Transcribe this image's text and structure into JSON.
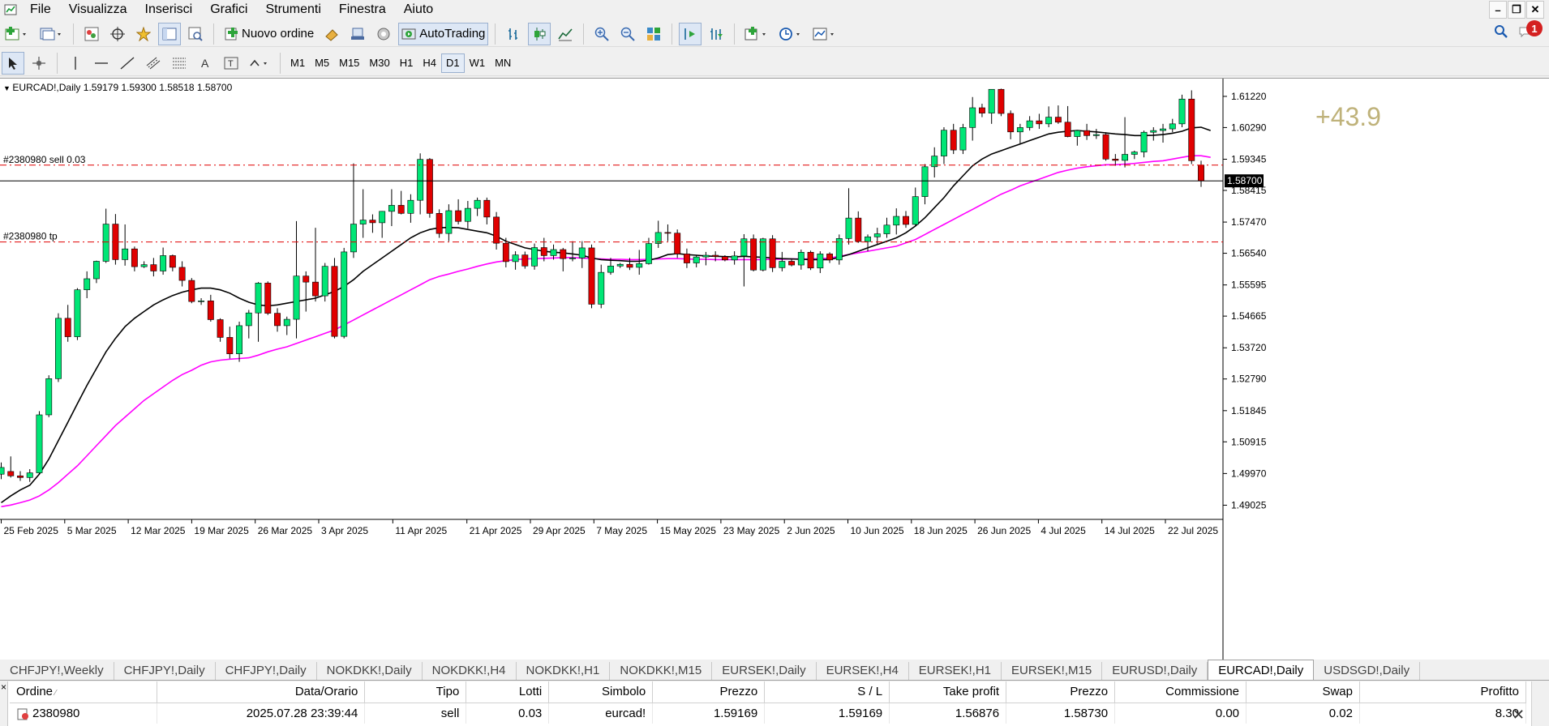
{
  "menu": {
    "items": [
      "File",
      "Visualizza",
      "Inserisci",
      "Grafici",
      "Strumenti",
      "Finestra",
      "Aiuto"
    ]
  },
  "toolbar": {
    "new_order_label": "Nuovo ordine",
    "autotrading_label": "AutoTrading",
    "notification_count": "1"
  },
  "timeframes": [
    "M1",
    "M5",
    "M15",
    "M30",
    "H1",
    "H4",
    "D1",
    "W1",
    "MN"
  ],
  "active_timeframe": "D1",
  "chart": {
    "title": "EURCAD!,Daily  1.59179 1.59300 1.58518 1.58700",
    "sell_label": "#2380980 sell 0.03",
    "tp_label": "#2380980 tp",
    "profit_overlay": "+43.9",
    "current_price_label": "1.58700",
    "price_ticks": [
      "1.61220",
      "1.60290",
      "1.59345",
      "1.58415",
      "1.57470",
      "1.56540",
      "1.55595",
      "1.54665",
      "1.53720",
      "1.52790",
      "1.51845",
      "1.50915",
      "1.49970",
      "1.49025"
    ],
    "date_ticks": [
      "25 Feb 2025",
      "5 Mar 2025",
      "12 Mar 2025",
      "19 Mar 2025",
      "26 Mar 2025",
      "3 Apr 2025",
      "11 Apr 2025",
      "21 Apr 2025",
      "29 Apr 2025",
      "7 May 2025",
      "15 May 2025",
      "23 May 2025",
      "2 Jun 2025",
      "10 Jun 2025",
      "18 Jun 2025",
      "26 Jun 2025",
      "4 Jul 2025",
      "14 Jul 2025",
      "22 Jul 2025"
    ]
  },
  "chart_data": {
    "type": "candlestick",
    "symbol": "EURCAD!",
    "timeframe": "Daily",
    "ylim": [
      1.4865,
      1.6175
    ],
    "sell_price": 1.59169,
    "tp_price": 1.56876,
    "current_price": 1.587,
    "colors": {
      "bull": "#00e676",
      "bear": "#e00000",
      "ma_fast": "#000000",
      "ma_slow": "#ff00ff",
      "order_line": "#e00000"
    },
    "candles": [
      [
        1.4995,
        1.503,
        1.498,
        1.5015
      ],
      [
        1.5003,
        1.5048,
        1.4985,
        1.499
      ],
      [
        1.499,
        1.5004,
        1.4975,
        1.4985
      ],
      [
        1.4985,
        1.501,
        1.4972,
        1.4999
      ],
      [
        1.4999,
        1.5183,
        1.4995,
        1.5172
      ],
      [
        1.5172,
        1.529,
        1.5165,
        1.528
      ],
      [
        1.528,
        1.5475,
        1.527,
        1.546
      ],
      [
        1.546,
        1.55,
        1.539,
        1.5405
      ],
      [
        1.5405,
        1.555,
        1.5395,
        1.5545
      ],
      [
        1.5545,
        1.56,
        1.552,
        1.5578
      ],
      [
        1.5578,
        1.5632,
        1.5565,
        1.563
      ],
      [
        1.563,
        1.5787,
        1.5625,
        1.5741
      ],
      [
        1.5741,
        1.5771,
        1.562,
        1.5635
      ],
      [
        1.5635,
        1.574,
        1.5617,
        1.5667
      ],
      [
        1.5667,
        1.5674,
        1.56,
        1.5614
      ],
      [
        1.5614,
        1.563,
        1.561,
        1.562
      ],
      [
        1.562,
        1.564,
        1.5585,
        1.5601
      ],
      [
        1.5601,
        1.5671,
        1.559,
        1.5647
      ],
      [
        1.5647,
        1.565,
        1.56,
        1.5612
      ],
      [
        1.5612,
        1.563,
        1.5555,
        1.5573
      ],
      [
        1.5573,
        1.558,
        1.5505,
        1.551
      ],
      [
        1.551,
        1.552,
        1.55,
        1.5512
      ],
      [
        1.5512,
        1.553,
        1.545,
        1.5456
      ],
      [
        1.5456,
        1.546,
        1.539,
        1.5403
      ],
      [
        1.5403,
        1.5435,
        1.534,
        1.5354
      ],
      [
        1.5354,
        1.545,
        1.533,
        1.5438
      ],
      [
        1.5438,
        1.5485,
        1.54,
        1.5476
      ],
      [
        1.5476,
        1.5568,
        1.539,
        1.5565
      ],
      [
        1.5565,
        1.557,
        1.547,
        1.5475
      ],
      [
        1.5475,
        1.549,
        1.542,
        1.5438
      ],
      [
        1.5438,
        1.5465,
        1.541,
        1.5457
      ],
      [
        1.5457,
        1.575,
        1.54,
        1.5586
      ],
      [
        1.5586,
        1.56,
        1.548,
        1.5568
      ],
      [
        1.5568,
        1.573,
        1.551,
        1.5527
      ],
      [
        1.5527,
        1.5625,
        1.551,
        1.5615
      ],
      [
        1.5615,
        1.564,
        1.54,
        1.5406
      ],
      [
        1.5406,
        1.567,
        1.54,
        1.5658
      ],
      [
        1.5658,
        1.5922,
        1.564,
        1.5741
      ],
      [
        1.5741,
        1.5845,
        1.57,
        1.5753
      ],
      [
        1.5753,
        1.577,
        1.5715,
        1.5745
      ],
      [
        1.5745,
        1.578,
        1.57,
        1.5779
      ],
      [
        1.5779,
        1.5845,
        1.5735,
        1.5797
      ],
      [
        1.5797,
        1.584,
        1.577,
        1.5773
      ],
      [
        1.5773,
        1.583,
        1.5745,
        1.5812
      ],
      [
        1.5812,
        1.5952,
        1.577,
        1.5934
      ],
      [
        1.5934,
        1.5938,
        1.576,
        1.5773
      ],
      [
        1.5773,
        1.5785,
        1.57,
        1.5713
      ],
      [
        1.5713,
        1.58,
        1.569,
        1.5781
      ],
      [
        1.5781,
        1.5815,
        1.574,
        1.5749
      ],
      [
        1.5749,
        1.581,
        1.5728,
        1.5788
      ],
      [
        1.5788,
        1.582,
        1.5765,
        1.5812
      ],
      [
        1.5812,
        1.582,
        1.574,
        1.5762
      ],
      [
        1.5762,
        1.5777,
        1.5665,
        1.5684
      ],
      [
        1.5684,
        1.57,
        1.5612,
        1.5629
      ],
      [
        1.5629,
        1.566,
        1.5605,
        1.5649
      ],
      [
        1.5649,
        1.5659,
        1.5608,
        1.5616
      ],
      [
        1.5616,
        1.5683,
        1.5605,
        1.5671
      ],
      [
        1.5671,
        1.57,
        1.563,
        1.5647
      ],
      [
        1.5647,
        1.568,
        1.5635,
        1.5665
      ],
      [
        1.5665,
        1.567,
        1.56,
        1.5638
      ],
      [
        1.5638,
        1.569,
        1.563,
        1.564
      ],
      [
        1.564,
        1.569,
        1.561,
        1.567
      ],
      [
        1.567,
        1.568,
        1.549,
        1.5502
      ],
      [
        1.5502,
        1.562,
        1.549,
        1.5597
      ],
      [
        1.5597,
        1.564,
        1.559,
        1.5616
      ],
      [
        1.5616,
        1.5625,
        1.561,
        1.5621
      ],
      [
        1.5621,
        1.564,
        1.5604,
        1.5612
      ],
      [
        1.5612,
        1.5664,
        1.559,
        1.5623
      ],
      [
        1.5623,
        1.57,
        1.562,
        1.5683
      ],
      [
        1.5683,
        1.5751,
        1.567,
        1.5716
      ],
      [
        1.5716,
        1.574,
        1.569,
        1.5714
      ],
      [
        1.5714,
        1.5725,
        1.564,
        1.5652
      ],
      [
        1.5652,
        1.5668,
        1.561,
        1.5625
      ],
      [
        1.5625,
        1.5648,
        1.5612,
        1.5643
      ],
      [
        1.5643,
        1.5658,
        1.5618,
        1.5648
      ],
      [
        1.5648,
        1.566,
        1.563,
        1.5644
      ],
      [
        1.5644,
        1.5648,
        1.563,
        1.5634
      ],
      [
        1.5634,
        1.566,
        1.562,
        1.5646
      ],
      [
        1.5646,
        1.5711,
        1.5555,
        1.5697
      ],
      [
        1.5697,
        1.571,
        1.56,
        1.5604
      ],
      [
        1.5604,
        1.57,
        1.56,
        1.5697
      ],
      [
        1.5697,
        1.5708,
        1.5598,
        1.5611
      ],
      [
        1.5611,
        1.5658,
        1.56,
        1.563
      ],
      [
        1.563,
        1.5635,
        1.5615,
        1.5619
      ],
      [
        1.5619,
        1.5665,
        1.5605,
        1.5657
      ],
      [
        1.5657,
        1.5662,
        1.5604,
        1.561
      ],
      [
        1.561,
        1.566,
        1.5595,
        1.5652
      ],
      [
        1.5652,
        1.5657,
        1.5625,
        1.5634
      ],
      [
        1.5634,
        1.571,
        1.562,
        1.5698
      ],
      [
        1.5698,
        1.5848,
        1.568,
        1.5759
      ],
      [
        1.5759,
        1.5779,
        1.5685,
        1.5689
      ],
      [
        1.5689,
        1.571,
        1.566,
        1.5703
      ],
      [
        1.5703,
        1.573,
        1.568,
        1.5712
      ],
      [
        1.5712,
        1.576,
        1.57,
        1.5738
      ],
      [
        1.5738,
        1.5788,
        1.571,
        1.5764
      ],
      [
        1.5764,
        1.578,
        1.573,
        1.574
      ],
      [
        1.574,
        1.585,
        1.5735,
        1.5823
      ],
      [
        1.5823,
        1.592,
        1.58,
        1.5912
      ],
      [
        1.5912,
        1.597,
        1.588,
        1.5944
      ],
      [
        1.5944,
        1.603,
        1.592,
        1.6021
      ],
      [
        1.6021,
        1.604,
        1.595,
        1.5962
      ],
      [
        1.5962,
        1.604,
        1.595,
        1.6029
      ],
      [
        1.6029,
        1.612,
        1.599,
        1.6088
      ],
      [
        1.6088,
        1.61,
        1.606,
        1.6072
      ],
      [
        1.6072,
        1.613,
        1.604,
        1.6143
      ],
      [
        1.6143,
        1.6145,
        1.6063,
        1.6071
      ],
      [
        1.6071,
        1.608,
        1.5994,
        1.6016
      ],
      [
        1.6016,
        1.604,
        1.598,
        1.6029
      ],
      [
        1.6029,
        1.6063,
        1.602,
        1.6049
      ],
      [
        1.6049,
        1.607,
        1.6025,
        1.604
      ],
      [
        1.604,
        1.6092,
        1.603,
        1.606
      ],
      [
        1.606,
        1.6095,
        1.604,
        1.6045
      ],
      [
        1.6045,
        1.6093,
        1.6,
        1.6002
      ],
      [
        1.6002,
        1.602,
        1.5975,
        1.602
      ],
      [
        1.602,
        1.604,
        1.5992,
        1.6005
      ],
      [
        1.6005,
        1.6025,
        1.5995,
        1.6008
      ],
      [
        1.6008,
        1.6015,
        1.593,
        1.5935
      ],
      [
        1.5935,
        1.595,
        1.5915,
        1.5931
      ],
      [
        1.5931,
        1.606,
        1.591,
        1.5949
      ],
      [
        1.5949,
        1.596,
        1.5935,
        1.5956
      ],
      [
        1.5956,
        1.602,
        1.594,
        1.6015
      ],
      [
        1.6015,
        1.603,
        1.599,
        1.602
      ],
      [
        1.602,
        1.604,
        1.5984,
        1.6025
      ],
      [
        1.6025,
        1.6055,
        1.6015,
        1.604
      ],
      [
        1.604,
        1.6127,
        1.603,
        1.6114
      ],
      [
        1.6114,
        1.614,
        1.592,
        1.593
      ],
      [
        1.5917,
        1.593,
        1.5852,
        1.587
      ]
    ],
    "ma_fast": [
      1.491,
      1.493,
      1.4948,
      1.4962,
      1.4995,
      1.504,
      1.5095,
      1.515,
      1.5205,
      1.526,
      1.531,
      1.536,
      1.54,
      1.5435,
      1.546,
      1.548,
      1.55,
      1.5515,
      1.5528,
      1.5538,
      1.5545,
      1.555,
      1.555,
      1.5545,
      1.5535,
      1.552,
      1.5508,
      1.55,
      1.5497,
      1.55,
      1.5505,
      1.551,
      1.5515,
      1.552,
      1.553,
      1.554,
      1.5555,
      1.5575,
      1.56,
      1.562,
      1.564,
      1.566,
      1.568,
      1.57,
      1.5715,
      1.5725,
      1.573,
      1.5731,
      1.573,
      1.5725,
      1.572,
      1.5715,
      1.5705,
      1.569,
      1.568,
      1.567,
      1.5665,
      1.566,
      1.5657,
      1.5655,
      1.5652,
      1.5648,
      1.564,
      1.5635,
      1.5633,
      1.5632,
      1.563,
      1.563,
      1.5633,
      1.564,
      1.565,
      1.5653,
      1.565,
      1.5648,
      1.5646,
      1.5645,
      1.5644,
      1.5643,
      1.5645,
      1.5643,
      1.5642,
      1.564,
      1.5638,
      1.5637,
      1.5636,
      1.5635,
      1.5635,
      1.5635,
      1.5642,
      1.565,
      1.566,
      1.567,
      1.568,
      1.569,
      1.57,
      1.5715,
      1.5735,
      1.576,
      1.579,
      1.582,
      1.5855,
      1.5885,
      1.5915,
      1.5935,
      1.595,
      1.596,
      1.597,
      1.598,
      1.599,
      1.6,
      1.601,
      1.6015,
      1.6018,
      1.602,
      1.6018,
      1.6016,
      1.6013,
      1.601,
      1.6008,
      1.6005,
      1.6005,
      1.6006,
      1.6008,
      1.6012,
      1.6018,
      1.6028,
      1.603,
      1.602
    ],
    "ma_slow": [
      1.4898,
      1.4903,
      1.491,
      1.4918,
      1.493,
      1.4948,
      1.497,
      1.4995,
      1.502,
      1.505,
      1.508,
      1.511,
      1.514,
      1.5165,
      1.519,
      1.5215,
      1.5235,
      1.5255,
      1.5275,
      1.5292,
      1.5305,
      1.532,
      1.533,
      1.5335,
      1.5338,
      1.534,
      1.5342,
      1.535,
      1.536,
      1.5368,
      1.5375,
      1.5385,
      1.5395,
      1.5405,
      1.5415,
      1.5425,
      1.544,
      1.5455,
      1.547,
      1.5485,
      1.55,
      1.5515,
      1.553,
      1.5545,
      1.556,
      1.5575,
      1.5585,
      1.5592,
      1.56,
      1.5607,
      1.5615,
      1.5622,
      1.5628,
      1.5632,
      1.5635,
      1.5637,
      1.5638,
      1.5639,
      1.564,
      1.5641,
      1.5641,
      1.564,
      1.5638,
      1.5637,
      1.5636,
      1.5636,
      1.5635,
      1.5635,
      1.5636,
      1.5637,
      1.5638,
      1.5638,
      1.5637,
      1.5636,
      1.5636,
      1.5635,
      1.5635,
      1.5635,
      1.5635,
      1.5635,
      1.5635,
      1.5636,
      1.5636,
      1.5637,
      1.5637,
      1.5637,
      1.5638,
      1.564,
      1.5645,
      1.565,
      1.5655,
      1.566,
      1.5665,
      1.567,
      1.5675,
      1.5685,
      1.5695,
      1.571,
      1.5725,
      1.574,
      1.5755,
      1.577,
      1.5785,
      1.58,
      1.5815,
      1.583,
      1.5842,
      1.5855,
      1.5865,
      1.5875,
      1.5885,
      1.5895,
      1.5902,
      1.5908,
      1.5912,
      1.5915,
      1.5918,
      1.5918,
      1.592,
      1.5922,
      1.5925,
      1.5928,
      1.593,
      1.5935,
      1.594,
      1.5945,
      1.5945,
      1.594
    ]
  },
  "tabs": [
    "CHFJPY!,Weekly",
    "CHFJPY!,Daily",
    "CHFJPY!,Daily",
    "NOKDKK!,Daily",
    "NOKDKK!,H4",
    "NOKDKK!,H1",
    "NOKDKK!,M15",
    "EURSEK!,Daily",
    "EURSEK!,H4",
    "EURSEK!,H1",
    "EURSEK!,M15",
    "EURUSD!,Daily",
    "EURCAD!,Daily",
    "USDSGD!,Daily"
  ],
  "active_tab": "EURCAD!,Daily",
  "orders_table": {
    "headers": [
      "Ordine",
      "Data/Orario",
      "Tipo",
      "Lotti",
      "Simbolo",
      "Prezzo",
      "S / L",
      "Take profit",
      "Prezzo",
      "Commissione",
      "Swap",
      "Profitto"
    ],
    "rows": [
      [
        "2380980",
        "2025.07.28 23:39:44",
        "sell",
        "0.03",
        "eurcad!",
        "1.59169",
        "1.59169",
        "1.56876",
        "1.58730",
        "0.00",
        "0.02",
        "8.30"
      ]
    ]
  }
}
